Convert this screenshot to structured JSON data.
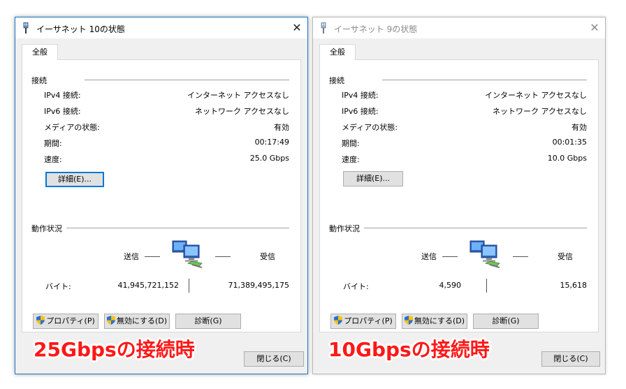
{
  "windows": [
    {
      "title": "イーサネット 10の状態",
      "tab": "全般",
      "connection_group": "接続",
      "rows": [
        {
          "label": "IPv4 接続:",
          "value": "インターネット アクセスなし"
        },
        {
          "label": "IPv6 接続:",
          "value": "ネットワーク アクセスなし"
        },
        {
          "label": "メディアの状態:",
          "value": "有効"
        },
        {
          "label": "期間:",
          "value": "00:17:49"
        },
        {
          "label": "速度:",
          "value": "25.0 Gbps"
        }
      ],
      "details_button": "詳細(E)...",
      "activity_group": "動作状況",
      "sent_label": "送信",
      "received_label": "受信",
      "bytes_label": "バイト:",
      "bytes_sent": "41,945,721,152",
      "bytes_received": "71,389,495,175",
      "properties_button": "プロパティ(P)",
      "disable_button": "無効にする(D)",
      "diagnose_button": "診断(G)",
      "close_button": "閉じる(C)",
      "caption": "25Gbpsの接続時"
    },
    {
      "title": "イーサネット 9の状態",
      "tab": "全般",
      "connection_group": "接続",
      "rows": [
        {
          "label": "IPv4 接続:",
          "value": "インターネット アクセスなし"
        },
        {
          "label": "IPv6 接続:",
          "value": "ネットワーク アクセスなし"
        },
        {
          "label": "メディアの状態:",
          "value": "有効"
        },
        {
          "label": "期間:",
          "value": "00:01:35"
        },
        {
          "label": "速度:",
          "value": "10.0 Gbps"
        }
      ],
      "details_button": "詳細(E)...",
      "activity_group": "動作状況",
      "sent_label": "送信",
      "received_label": "受信",
      "bytes_label": "バイト:",
      "bytes_sent": "4,590",
      "bytes_received": "15,618",
      "properties_button": "プロパティ(P)",
      "disable_button": "無効にする(D)",
      "diagnose_button": "診断(G)",
      "close_button": "閉じる(C)",
      "caption": "10Gbpsの接続時"
    }
  ],
  "colors": {
    "active_border": "#1a73c6",
    "caption_red": "#ff1818",
    "focus_blue": "#0078d7"
  },
  "icons": {
    "title": "network-adapter-icon",
    "close": "close-icon",
    "network": "network-computers-icon",
    "shield": "uac-shield-icon"
  }
}
